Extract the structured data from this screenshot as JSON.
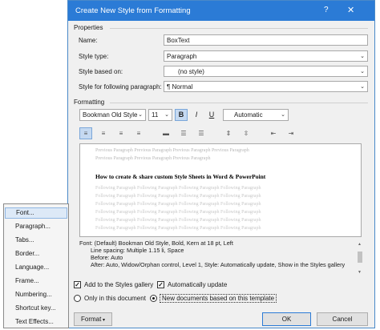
{
  "dialog": {
    "title": "Create New Style from Formatting",
    "help_glyph": "?",
    "close_glyph": "✕"
  },
  "properties": {
    "section_label": "Properties",
    "name_label": "Name:",
    "name_value": "BoxText",
    "style_type_label": "Style type:",
    "style_type_value": "Paragraph",
    "based_on_label": "Style based on:",
    "based_on_value": "(no style)",
    "following_label": "Style for following paragraph:",
    "following_value": "¶ Normal"
  },
  "formatting": {
    "section_label": "Formatting",
    "font_name": "Bookman Old Style",
    "font_size": "11",
    "bold": "B",
    "italic": "I",
    "underline": "U",
    "color": "Automatic"
  },
  "preview": {
    "previous": "Previous Paragraph Previous Paragraph Previous Paragraph Previous Paragraph",
    "previous2": "Previous Paragraph Previous Paragraph Previous Paragraph",
    "sample": "How to create & share custom Style Sheets in Word & PowerPoint",
    "following": [
      "Following Paragraph Following Paragraph Following Paragraph Following Paragraph",
      "Following Paragraph Following Paragraph Following Paragraph Following Paragraph",
      "Following Paragraph Following Paragraph Following Paragraph Following Paragraph",
      "Following Paragraph Following Paragraph Following Paragraph Following Paragraph",
      "Following Paragraph Following Paragraph Following Paragraph Following Paragraph",
      "Following Paragraph Following Paragraph Following Paragraph Following Paragraph"
    ]
  },
  "description": {
    "line1": "Font: (Default) Bookman Old Style, Bold, Kern at 18 pt, Left",
    "line2": "Line spacing:  Multiple 1.15 li, Space",
    "line3": "Before:  Auto",
    "line4": "After:  Auto, Widow/Orphan control, Level 1, Style: Automatically update, Show in the Styles gallery"
  },
  "options": {
    "add_to_gallery": "Add to the Styles gallery",
    "auto_update": "Automatically update",
    "only_this_doc": "Only in this document",
    "new_docs": "New documents based on this template"
  },
  "buttons": {
    "format": "Format",
    "ok": "OK",
    "cancel": "Cancel"
  },
  "menu": {
    "items": [
      "Font...",
      "Paragraph...",
      "Tabs...",
      "Border...",
      "Language...",
      "Frame...",
      "Numbering...",
      "Shortcut key...",
      "Text Effects..."
    ]
  },
  "colors": {
    "titlebar": "#2b7bd6",
    "menu_highlight": "#dde9f7"
  }
}
